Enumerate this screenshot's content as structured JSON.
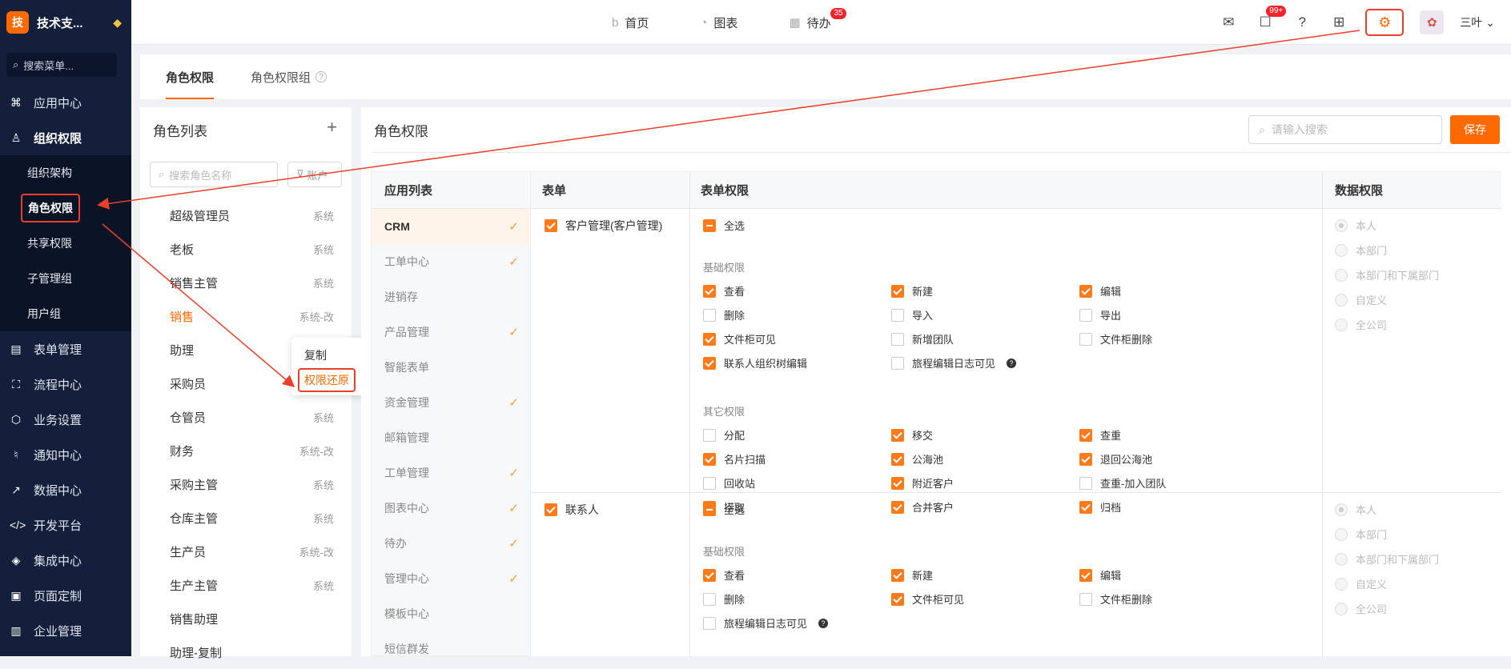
{
  "brand": {
    "logo": "技",
    "name": "技术支..."
  },
  "sidebar": {
    "search_placeholder": "搜索菜单...",
    "items": [
      {
        "label": "应用中心",
        "icon": "grid-icon"
      },
      {
        "label": "组织权限",
        "icon": "user-icon"
      },
      {
        "label": "表单管理",
        "icon": "form-icon"
      },
      {
        "label": "流程中心",
        "icon": "flow-icon"
      },
      {
        "label": "业务设置",
        "icon": "cube-icon"
      },
      {
        "label": "通知中心",
        "icon": "bell-icon"
      },
      {
        "label": "数据中心",
        "icon": "chart-icon"
      },
      {
        "label": "开发平台",
        "icon": "code-icon"
      },
      {
        "label": "集成中心",
        "icon": "layers-icon"
      },
      {
        "label": "页面定制",
        "icon": "layout-icon"
      },
      {
        "label": "企业管理",
        "icon": "building-icon"
      }
    ],
    "sub_items": [
      "组织架构",
      "角色权限",
      "共享权限",
      "子管理组",
      "用户组"
    ]
  },
  "topnav": {
    "home": "首页",
    "charts": "图表",
    "todo": "待办",
    "todo_badge": "35",
    "msg_badge": "99+",
    "user": "三叶"
  },
  "tabs": {
    "role_perm": "角色权限",
    "role_group": "角色权限组"
  },
  "role_panel": {
    "title": "角色列表",
    "search_placeholder": "搜索角色名称",
    "filter_label": "账户",
    "roles": [
      {
        "name": "超级管理员",
        "tag": "系统"
      },
      {
        "name": "老板",
        "tag": "系统"
      },
      {
        "name": "销售主管",
        "tag": "系统"
      },
      {
        "name": "销售",
        "tag": "系统-改"
      },
      {
        "name": "助理",
        "tag": ""
      },
      {
        "name": "采购员",
        "tag": ""
      },
      {
        "name": "仓管员",
        "tag": "系统"
      },
      {
        "name": "财务",
        "tag": "系统-改"
      },
      {
        "name": "采购主管",
        "tag": "系统"
      },
      {
        "name": "仓库主管",
        "tag": "系统"
      },
      {
        "name": "生产员",
        "tag": "系统-改"
      },
      {
        "name": "生产主管",
        "tag": "系统"
      },
      {
        "name": "销售助理",
        "tag": ""
      },
      {
        "name": "助理-复制",
        "tag": ""
      }
    ],
    "context_menu": {
      "copy": "复制",
      "restore": "权限还原"
    }
  },
  "main": {
    "title": "角色权限",
    "search_placeholder": "请输入搜索",
    "save": "保存",
    "headers": {
      "apps": "应用列表",
      "form": "表单",
      "form_perm": "表单权限",
      "data_perm": "数据权限"
    },
    "apps": [
      {
        "name": "CRM",
        "checked": true
      },
      {
        "name": "工单中心",
        "checked": true
      },
      {
        "name": "进销存",
        "checked": false
      },
      {
        "name": "产品管理",
        "checked": true
      },
      {
        "name": "智能表单",
        "checked": false
      },
      {
        "name": "资金管理",
        "checked": true
      },
      {
        "name": "邮箱管理",
        "checked": false
      },
      {
        "name": "工单管理",
        "checked": true
      },
      {
        "name": "图表中心",
        "checked": true
      },
      {
        "name": "待办",
        "checked": true
      },
      {
        "name": "管理中心",
        "checked": true
      },
      {
        "name": "模板中心",
        "checked": false
      },
      {
        "name": "短信群发",
        "checked": false
      }
    ],
    "select_all": "全选",
    "basic_label": "基础权限",
    "other_label": "其它权限",
    "forms": [
      {
        "name": "客户管理(客户管理)",
        "basic": [
          {
            "label": "查看",
            "on": true
          },
          {
            "label": "新建",
            "on": true
          },
          {
            "label": "编辑",
            "on": true
          },
          {
            "label": "删除",
            "on": false
          },
          {
            "label": "导入",
            "on": false
          },
          {
            "label": "导出",
            "on": false
          },
          {
            "label": "文件柜可见",
            "on": true
          },
          {
            "label": "新增团队",
            "on": false
          },
          {
            "label": "文件柜删除",
            "on": false
          },
          {
            "label": "联系人组织树编辑",
            "on": true
          },
          {
            "label": "旅程编辑日志可见",
            "on": false
          }
        ],
        "other": [
          {
            "label": "分配",
            "on": false
          },
          {
            "label": "移交",
            "on": true
          },
          {
            "label": "查重",
            "on": true
          },
          {
            "label": "名片扫描",
            "on": true
          },
          {
            "label": "公海池",
            "on": true
          },
          {
            "label": "退回公海池",
            "on": true
          },
          {
            "label": "回收站",
            "on": false
          },
          {
            "label": "附近客户",
            "on": true
          },
          {
            "label": "查重-加入团队",
            "on": false
          },
          {
            "label": "捞取",
            "on": true
          },
          {
            "label": "合并客户",
            "on": true
          },
          {
            "label": "归档",
            "on": true
          }
        ]
      },
      {
        "name": "联系人",
        "basic": [
          {
            "label": "查看",
            "on": true
          },
          {
            "label": "新建",
            "on": true
          },
          {
            "label": "编辑",
            "on": true
          },
          {
            "label": "删除",
            "on": false
          },
          {
            "label": "文件柜可见",
            "on": true
          },
          {
            "label": "文件柜删除",
            "on": false
          },
          {
            "label": "旅程编辑日志可见",
            "on": false
          }
        ]
      }
    ],
    "data_options": [
      "本人",
      "本部门",
      "本部门和下属部门",
      "自定义",
      "全公司"
    ]
  }
}
